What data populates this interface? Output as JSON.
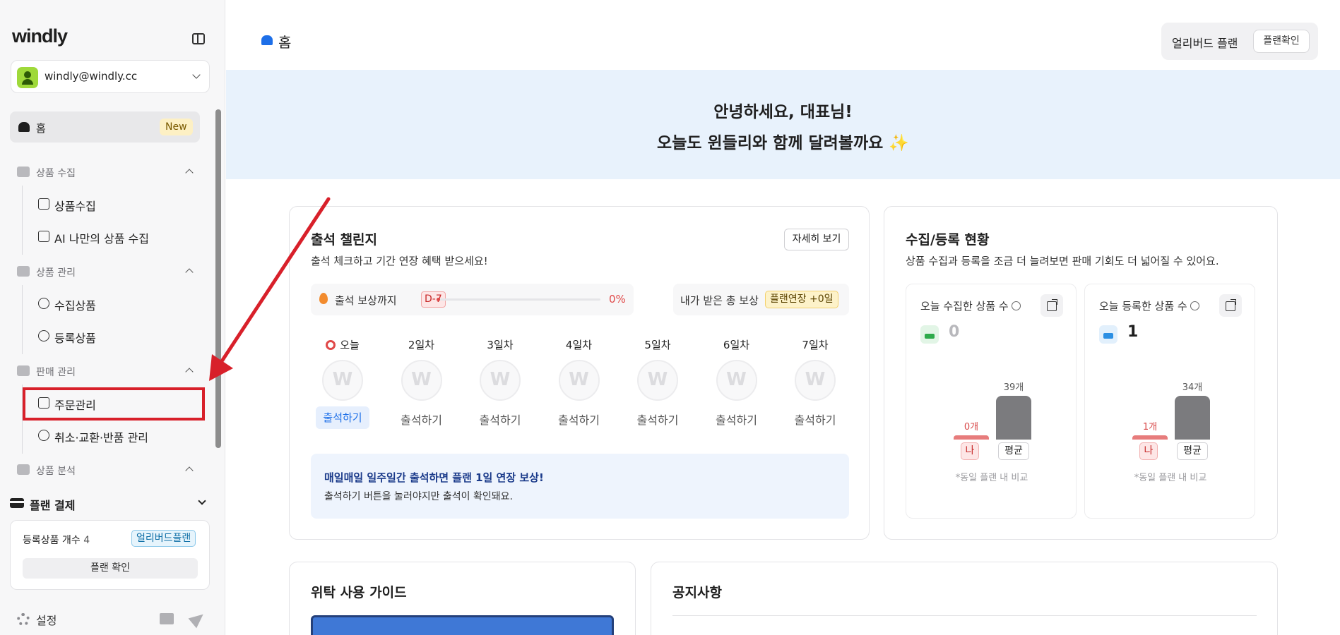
{
  "sidebar": {
    "logo": "windly",
    "account": {
      "email": "windly@windly.cc"
    },
    "home": {
      "label": "홈",
      "badge": "New"
    },
    "sections": [
      {
        "label": "상품 수집",
        "items": [
          {
            "label": "상품수집",
            "icon": "download-icon"
          },
          {
            "label": "AI 나만의 상품 수집",
            "icon": "sparkles-icon"
          }
        ]
      },
      {
        "label": "상품 관리",
        "items": [
          {
            "label": "수집상품",
            "icon": "arrow-down-circle-icon"
          },
          {
            "label": "등록상품",
            "icon": "arrow-up-circle-icon"
          }
        ]
      },
      {
        "label": "판매 관리",
        "items": [
          {
            "label": "주문관리",
            "icon": "clipboard-check-icon"
          },
          {
            "label": "취소·교환·반품 관리",
            "icon": "headphones-icon"
          }
        ]
      },
      {
        "label": "상품 분석",
        "items": []
      }
    ],
    "plan_pay": {
      "label": "플랜 결제"
    },
    "plan_card": {
      "label": "등록상품 개수",
      "count": "4",
      "badge": "얼리버드플랜",
      "button": "플랜 확인"
    },
    "settings": {
      "label": "설정"
    }
  },
  "header": {
    "title": "홈",
    "plan": {
      "label": "얼리버드 플랜",
      "button": "플랜확인"
    }
  },
  "hero": {
    "line1": "안녕하세요, 대표님!",
    "line2": "오늘도 윈들리와 함께 달려볼까요",
    "emoji": "✨"
  },
  "attendance": {
    "title": "출석 챌린지",
    "desc": "출석 체크하고 기간 연장 혜택 받으세요!",
    "detail_button": "자세히 보기",
    "progress": {
      "label": "출석 보상까지",
      "dday": "D-7",
      "percent_text": "0%",
      "fraction": 0
    },
    "reward": {
      "label": "내가 받은 총 보상",
      "badge": "플랜연장 +0일"
    },
    "days": [
      {
        "label": "오늘",
        "action": "출석하기",
        "today": true
      },
      {
        "label": "2일차",
        "action": "출석하기",
        "today": false
      },
      {
        "label": "3일차",
        "action": "출석하기",
        "today": false
      },
      {
        "label": "4일차",
        "action": "출석하기",
        "today": false
      },
      {
        "label": "5일차",
        "action": "출석하기",
        "today": false
      },
      {
        "label": "6일차",
        "action": "출석하기",
        "today": false
      },
      {
        "label": "7일차",
        "action": "출석하기",
        "today": false
      }
    ],
    "info": {
      "title": "매일매일 일주일간 출석하면 플랜 1일 연장 보상!",
      "desc": "출석하기 버튼을 눌러야지만 출석이 확인돼요."
    }
  },
  "stats": {
    "title": "수집/등록 현황",
    "desc": "상품 수집과 등록을 조금 더 늘려보면 판매 기회도 더 넓어질 수 있어요.",
    "collected": {
      "label": "오늘 수집한 상품 수",
      "value": "0",
      "me_value": 0,
      "me_label": "0개",
      "avg_value": 39,
      "avg_label": "39개",
      "me_tag": "나",
      "avg_tag": "평균",
      "note": "*동일 플랜 내 비교"
    },
    "registered": {
      "label": "오늘 등록한 상품 수",
      "value": "1",
      "me_value": 1,
      "me_label": "1개",
      "avg_value": 34,
      "avg_label": "34개",
      "me_tag": "나",
      "avg_tag": "평균",
      "note": "*동일 플랜 내 비교"
    }
  },
  "guide": {
    "title": "위탁 사용 가이드"
  },
  "notice": {
    "title": "공지사항"
  },
  "colors": {
    "accent": "#1d6fe8",
    "highlight": "#d8202a",
    "hero_bg": "#e8f2fc"
  }
}
